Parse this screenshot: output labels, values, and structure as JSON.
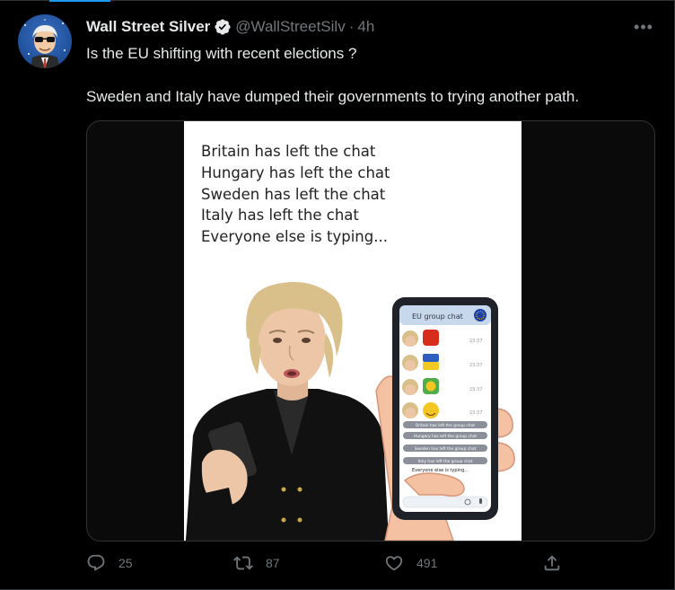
{
  "tweet": {
    "author_name": "Wall Street Silver",
    "handle": "@WallStreetSilv",
    "separator": "·",
    "time": "4h",
    "more_label": "•••",
    "text_paragraphs": [
      "Is the EU shifting with recent elections ?",
      "Sweden and Italy have dumped their governments to trying another path."
    ]
  },
  "meme": {
    "lines": [
      "Britain has left the chat",
      "Hungary has left the chat",
      "Sweden has left the chat",
      "Italy has left the chat",
      "Everyone else is typing..."
    ],
    "phone": {
      "chat_title": "EU group chat",
      "timestamps": [
        "23:37",
        "23:37",
        "23:37",
        "23:37"
      ],
      "messages": [
        "Britain has left the group chat",
        "Hungary has left the group chat",
        "Sweden has left the group chat",
        "Italy has left the group chat"
      ],
      "typing": "Everyone else is typing..."
    }
  },
  "actions": {
    "reply_count": "25",
    "retweet_count": "87",
    "like_count": "491"
  },
  "colors": {
    "background": "#000000",
    "text": "#e7e9ea",
    "muted": "#71767b",
    "accent": "#1d9bf0",
    "border": "#2f3336"
  },
  "icons": {
    "verified": "verified-badge-icon",
    "more": "more-options-icon",
    "reply": "reply-icon",
    "retweet": "retweet-icon",
    "like": "heart-icon",
    "share": "share-icon"
  }
}
